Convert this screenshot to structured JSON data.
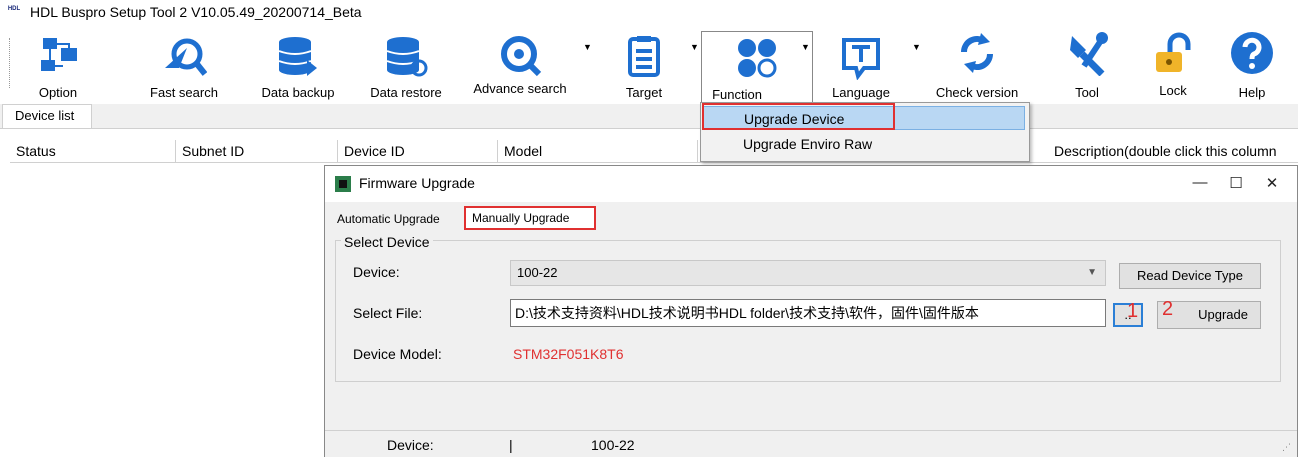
{
  "window": {
    "logo_text": "HDL",
    "title": "HDL Buspro Setup Tool 2 V10.05.49_20200714_Beta"
  },
  "toolbar": {
    "option": "Option",
    "fast_search": "Fast search",
    "data_backup": "Data backup",
    "data_restore": "Data restore",
    "advance_search": "Advance search",
    "target": "Target",
    "function": "Function",
    "language": "Language",
    "check_version": "Check version",
    "tool": "Tool",
    "lock": "Lock",
    "help": "Help"
  },
  "function_menu": {
    "items": [
      "Upgrade Device",
      "Upgrade Enviro Raw"
    ]
  },
  "device_list": {
    "tab": "Device list",
    "columns": [
      "Status",
      "Subnet ID",
      "Device ID",
      "Model",
      "Description(double click this column"
    ]
  },
  "dialog": {
    "title": "Firmware Upgrade",
    "controls": {
      "minimize": "—",
      "maximize": "☐",
      "close": "✕"
    },
    "tabs": [
      "Automatic Upgrade",
      "Manually Upgrade"
    ],
    "group_label": "Select Device",
    "device_label": "Device:",
    "device_value": "100-22",
    "read_device_type": "Read Device Type",
    "select_file_label": "Select File:",
    "file_path": "D:\\技术支持资料\\HDL技术说明书HDL folder\\技术支持\\软件，固件\\固件版本",
    "browse": "..",
    "upgrade": "Upgrade",
    "device_model_label": "Device Model:",
    "device_model_value": "STM32F051K8T6",
    "status_device_label": "Device:",
    "status_separator": "|",
    "status_device_value": "100-22"
  },
  "annotations": {
    "step1": "1",
    "step2": "2"
  },
  "colors": {
    "accent_blue": "#1e6fd0",
    "highlight_red": "#e03030",
    "menu_selected": "#b9d7f3"
  }
}
